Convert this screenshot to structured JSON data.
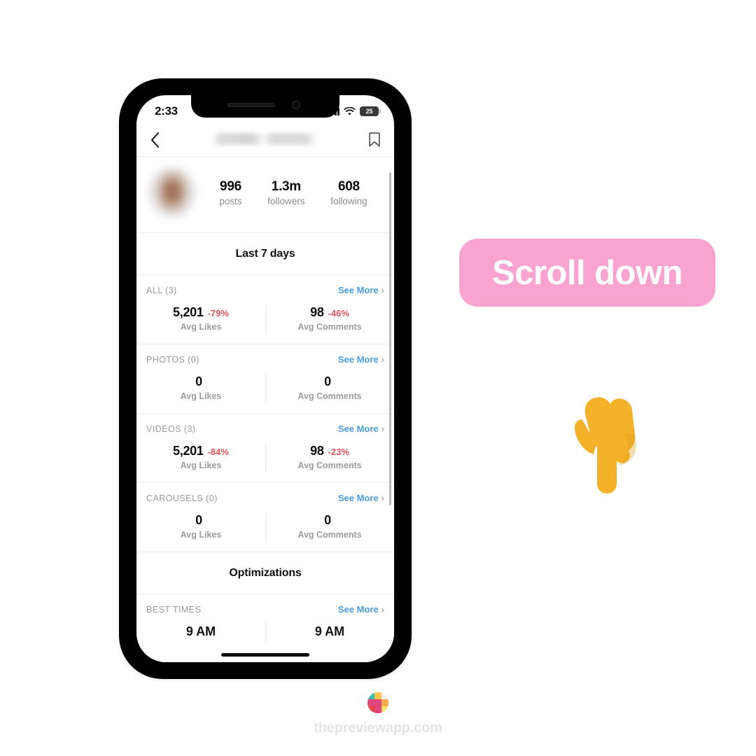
{
  "phone": {
    "status_bar": {
      "time": "2:33",
      "signal_icon": "cellular-signal-icon",
      "wifi_icon": "wifi-icon",
      "battery_percent": "25"
    },
    "navbar": {
      "back_icon": "chevron-left-icon",
      "title": "",
      "title_state": "blurred",
      "save_icon": "bookmark-icon"
    },
    "profile": {
      "avatar": "blurred-profile-photo",
      "stats": [
        {
          "value": "996",
          "label": "posts"
        },
        {
          "value": "1.3m",
          "label": "followers"
        },
        {
          "value": "608",
          "label": "following"
        }
      ]
    },
    "sections": [
      {
        "kind": "title",
        "title": "Last 7 days"
      },
      {
        "kind": "metrics",
        "label": "ALL (3)",
        "see_more": "See More",
        "chevron": "›",
        "metrics": [
          {
            "value": "5,201",
            "delta": "-79%",
            "label": "Avg Likes"
          },
          {
            "value": "98",
            "delta": "-46%",
            "label": "Avg Comments"
          }
        ]
      },
      {
        "kind": "metrics",
        "label": "PHOTOS (0)",
        "see_more": "See More",
        "chevron": "›",
        "metrics": [
          {
            "value": "0",
            "delta": "",
            "label": "Avg Likes"
          },
          {
            "value": "0",
            "delta": "",
            "label": "Avg Comments"
          }
        ]
      },
      {
        "kind": "metrics",
        "label": "VIDEOS (3)",
        "see_more": "See More",
        "chevron": "›",
        "metrics": [
          {
            "value": "5,201",
            "delta": "-84%",
            "label": "Avg Likes"
          },
          {
            "value": "98",
            "delta": "-23%",
            "label": "Avg Comments"
          }
        ]
      },
      {
        "kind": "metrics",
        "label": "CAROUSELS (0)",
        "see_more": "See More",
        "chevron": "›",
        "metrics": [
          {
            "value": "0",
            "delta": "",
            "label": "Avg Likes"
          },
          {
            "value": "0",
            "delta": "",
            "label": "Avg Comments"
          }
        ]
      },
      {
        "kind": "title",
        "title": "Optimizations"
      },
      {
        "kind": "clipped",
        "label": "BEST TIMES",
        "see_more": "See More",
        "chevron": "›",
        "values": [
          "9 AM",
          "9 AM"
        ]
      }
    ]
  },
  "callout": {
    "badge_text": "Scroll down",
    "badge_color": "#f9a3d0",
    "badge_text_color": "#ffffff",
    "hand_icon": "pointing-down-hand-icon"
  },
  "footer": {
    "logo_icon": "preview-app-logo-icon",
    "logo_colors": [
      "#3fb8b0",
      "#f4c64a",
      "#f0f0f0",
      "#e0457b",
      "#e0457b",
      "#f4a94a",
      "#e8433a",
      "#e0457b",
      "#f2e06a"
    ],
    "site": "thepreviewapp.com"
  },
  "colors": {
    "accent_blue": "#4a9ee0",
    "negative_red": "#e0565b",
    "muted_gray": "#9a9a9a",
    "pink": "#f9a3d0"
  }
}
